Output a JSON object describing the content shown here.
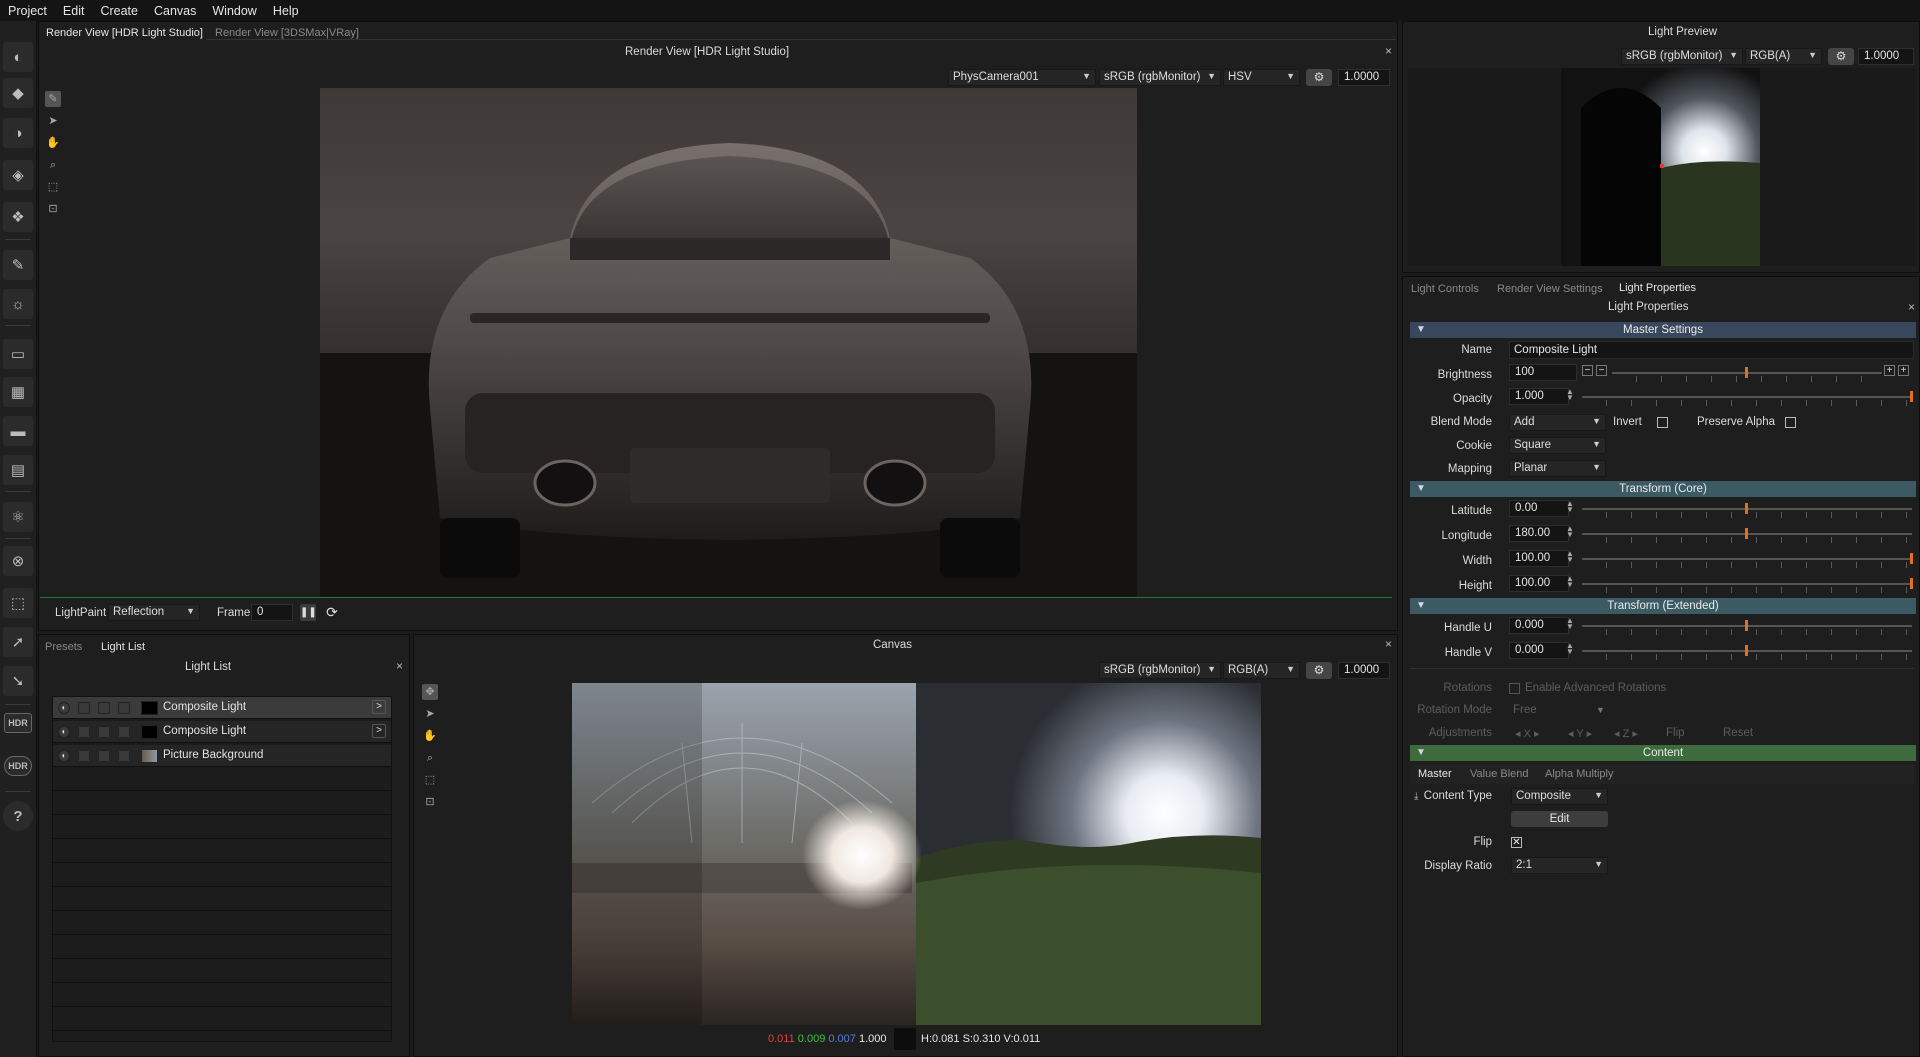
{
  "menu": [
    "Project",
    "Edit",
    "Create",
    "Canvas",
    "Window",
    "Help"
  ],
  "toolbar": {
    "hdr_label": "HDR",
    "hdr2_label": "HDR",
    "help_label": "?"
  },
  "render_view": {
    "tabs": [
      "Render View [HDR Light Studio]",
      "Render View [3DSMax|VRay]"
    ],
    "title": "Render View [HDR Light Studio]",
    "camera": "PhysCamera001",
    "color_space": "sRGB (rgbMonitor)",
    "mode": "HSV",
    "exposure": "1.0000",
    "lightpaint_label": "LightPaint",
    "lightpaint_mode": "Reflection",
    "frame_label": "Frame",
    "frame_value": "0"
  },
  "light_list": {
    "tabs": [
      "Presets",
      "Light List"
    ],
    "title": "Light List",
    "items": [
      {
        "name": "Composite Light",
        "selected": true
      },
      {
        "name": "Composite Light",
        "selected": false
      },
      {
        "name": "Picture Background",
        "selected": false
      }
    ]
  },
  "canvas": {
    "title": "Canvas",
    "color_space": "sRGB (rgbMonitor)",
    "channels": "RGB(A)",
    "exposure": "1.0000",
    "status": {
      "r": "0.011",
      "g": "0.009",
      "b": "0.007",
      "a": "1.000",
      "hsv": "H:0.081 S:0.310 V:0.011"
    }
  },
  "light_preview": {
    "title": "Light Preview",
    "color_space": "sRGB (rgbMonitor)",
    "channels": "RGB(A)",
    "exposure": "1.0000"
  },
  "properties": {
    "tabs": [
      "Light Controls",
      "Render View Settings",
      "Light Properties"
    ],
    "title": "Light Properties",
    "master_settings": "Master Settings",
    "name_label": "Name",
    "name_value": "Composite Light",
    "brightness_label": "Brightness",
    "brightness_value": "100",
    "brightness_level": 0.5,
    "opacity_label": "Opacity",
    "opacity_value": "1.000",
    "opacity_level": 1.0,
    "blend_label": "Blend Mode",
    "blend_value": "Add",
    "invert_label": "Invert",
    "preserve_alpha_label": "Preserve Alpha",
    "cookie_label": "Cookie",
    "cookie_value": "Square",
    "mapping_label": "Mapping",
    "mapping_value": "Planar",
    "transform_core": "Transform (Core)",
    "latitude_label": "Latitude",
    "latitude_value": "0.00",
    "latitude_level": 0.5,
    "longitude_label": "Longitude",
    "longitude_value": "180.00",
    "longitude_level": 0.5,
    "width_label": "Width",
    "width_value": "100.00",
    "width_level": 1.0,
    "height_label": "Height",
    "height_value": "100.00",
    "height_level": 1.0,
    "transform_ext": "Transform (Extended)",
    "handle_u_label": "Handle U",
    "handle_u_value": "0.000",
    "handle_u_level": 0.5,
    "handle_v_label": "Handle V",
    "handle_v_value": "0.000",
    "handle_v_level": 0.5,
    "rotations_label": "Rotations",
    "enable_adv_rot": "Enable Advanced Rotations",
    "rotation_mode_label": "Rotation Mode",
    "rotation_mode_value": "Free",
    "adjustments_label": "Adjustments",
    "adj_x": "X",
    "adj_y": "Y",
    "adj_z": "Z",
    "flip_btn": "Flip",
    "reset_btn": "Reset",
    "content": "Content",
    "content_tabs": [
      "Master",
      "Value Blend",
      "Alpha Multiply"
    ],
    "content_type_label": "Content Type",
    "content_type_value": "Composite",
    "edit_btn": "Edit",
    "flip_label": "Flip",
    "display_ratio_label": "Display Ratio",
    "display_ratio_value": "2:1"
  },
  "colors": {
    "accent_orange": "#e0701c",
    "section_blue": "#39475e",
    "section_teal": "#3c5a64",
    "section_green": "#3e6b3e",
    "status_r": "#e04040",
    "status_g": "#40c040",
    "status_b": "#5a7ad8"
  }
}
